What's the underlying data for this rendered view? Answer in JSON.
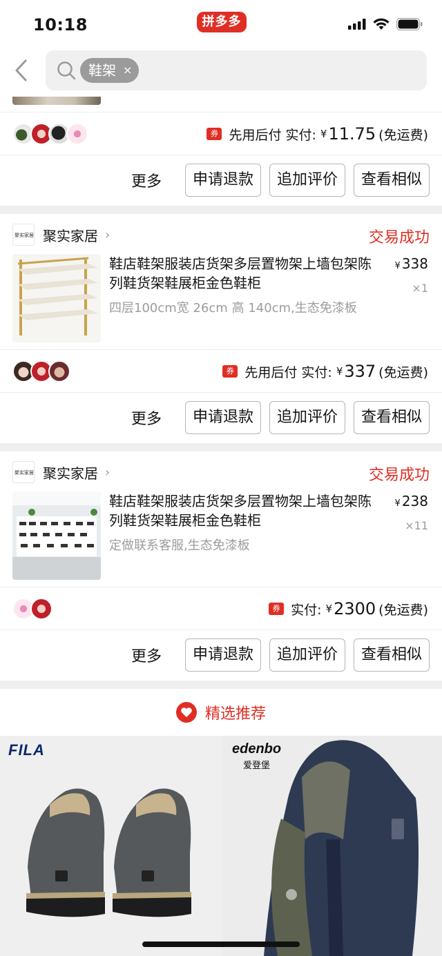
{
  "status_bar": {
    "time": "10:18",
    "app_badge": "拼多多"
  },
  "search": {
    "tag": "鞋架",
    "clear_symbol": "×"
  },
  "orders": [
    {
      "payment_label": "先用后付",
      "paid_label": "实付:",
      "currency": "¥",
      "amount": "11.75",
      "shipping": "(免运费)",
      "actions": {
        "more": "更多",
        "refund": "申请退款",
        "review": "追加评价",
        "similar": "查看相似"
      }
    },
    {
      "shop": "聚实家居",
      "status": "交易成功",
      "title": "鞋店鞋架服装店货架多层置物架上墙包架陈列鞋货架鞋展柜金色鞋柜",
      "spec": "四层100cm宽 26cm 高 140cm,生态免漆板",
      "price": "338",
      "qty": "×1",
      "payment_label": "先用后付",
      "paid_label": "实付:",
      "currency": "¥",
      "amount": "337",
      "shipping": "(免运费)",
      "actions": {
        "more": "更多",
        "refund": "申请退款",
        "review": "追加评价",
        "similar": "查看相似"
      }
    },
    {
      "shop": "聚实家居",
      "status": "交易成功",
      "title": "鞋店鞋架服装店货架多层置物架上墙包架陈列鞋货架鞋展柜金色鞋柜",
      "spec": "定做联系客服,生态免漆板",
      "price": "238",
      "qty": "×11",
      "paid_label": "实付:",
      "currency": "¥",
      "amount": "2300",
      "shipping": "(免运费)",
      "actions": {
        "more": "更多",
        "refund": "申请退款",
        "review": "追加评价",
        "similar": "查看相似"
      }
    }
  ],
  "coupon_glyph": "券",
  "shop_logo_text": "聚实家居",
  "recommend": {
    "title": "精选推荐"
  },
  "recommendations": [
    {
      "brand": "FILA"
    },
    {
      "brand": "edenbo",
      "brand_sub": "爱登堡"
    }
  ],
  "colors": {
    "accent": "#e02e24",
    "text": "#151516",
    "muted": "#9c9c9c"
  }
}
